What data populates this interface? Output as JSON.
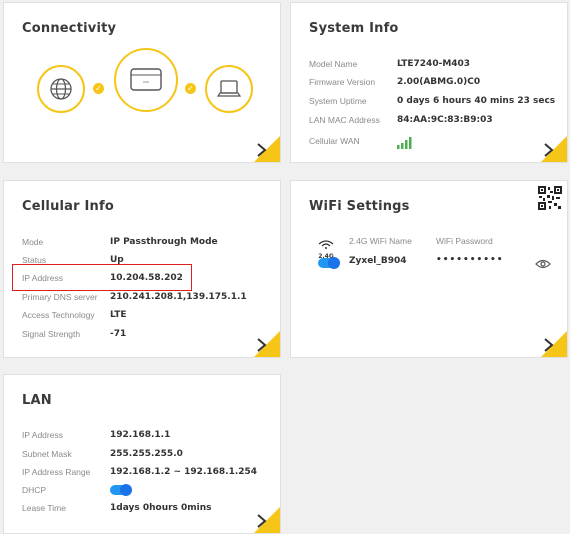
{
  "connectivity": {
    "title": "Connectivity"
  },
  "system_info": {
    "title": "System Info",
    "rows": [
      {
        "label": "Model Name",
        "value": "LTE7240-M403"
      },
      {
        "label": "Firmware Version",
        "value": "2.00(ABMG.0)C0"
      },
      {
        "label": "System Uptime",
        "value": "0 days 6 hours 40 mins 23 secs"
      },
      {
        "label": "LAN MAC Address",
        "value": "84:AA:9C:83:B9:03"
      },
      {
        "label": "Cellular WAN",
        "value": ""
      }
    ]
  },
  "cellular_info": {
    "title": "Cellular Info",
    "rows": [
      {
        "label": "Mode",
        "value": "IP Passthrough Mode"
      },
      {
        "label": "Status",
        "value": "Up"
      },
      {
        "label": "IP Address",
        "value": "10.204.58.202"
      },
      {
        "label": "Primary DNS server",
        "value": "210.241.208.1,139.175.1.1"
      },
      {
        "label": "Access Technology",
        "value": "LTE"
      },
      {
        "label": "Signal Strength",
        "value": "-71"
      }
    ]
  },
  "wifi_settings": {
    "title": "WiFi Settings",
    "band_badge": "2.4G",
    "col_name": "2.4G WiFi Name",
    "col_password": "WiFi Password",
    "ssid": "Zyxel_B904",
    "password_masked": "••••••••••",
    "enabled": true
  },
  "lan": {
    "title": "LAN",
    "rows": [
      {
        "label": "IP Address",
        "value": "192.168.1.1"
      },
      {
        "label": "Subnet Mask",
        "value": "255.255.255.0"
      },
      {
        "label": "IP Address Range",
        "value": "192.168.1.2 ~ 192.168.1.254"
      },
      {
        "label": "DHCP",
        "value": ""
      },
      {
        "label": "Lease Time",
        "value": "1days 0hours 0mins"
      }
    ],
    "dhcp_enabled": true
  },
  "colors": {
    "accent": "#f5c518",
    "toggle": "#2196f3",
    "highlight": "#e02020",
    "signal": "#4caf50"
  }
}
